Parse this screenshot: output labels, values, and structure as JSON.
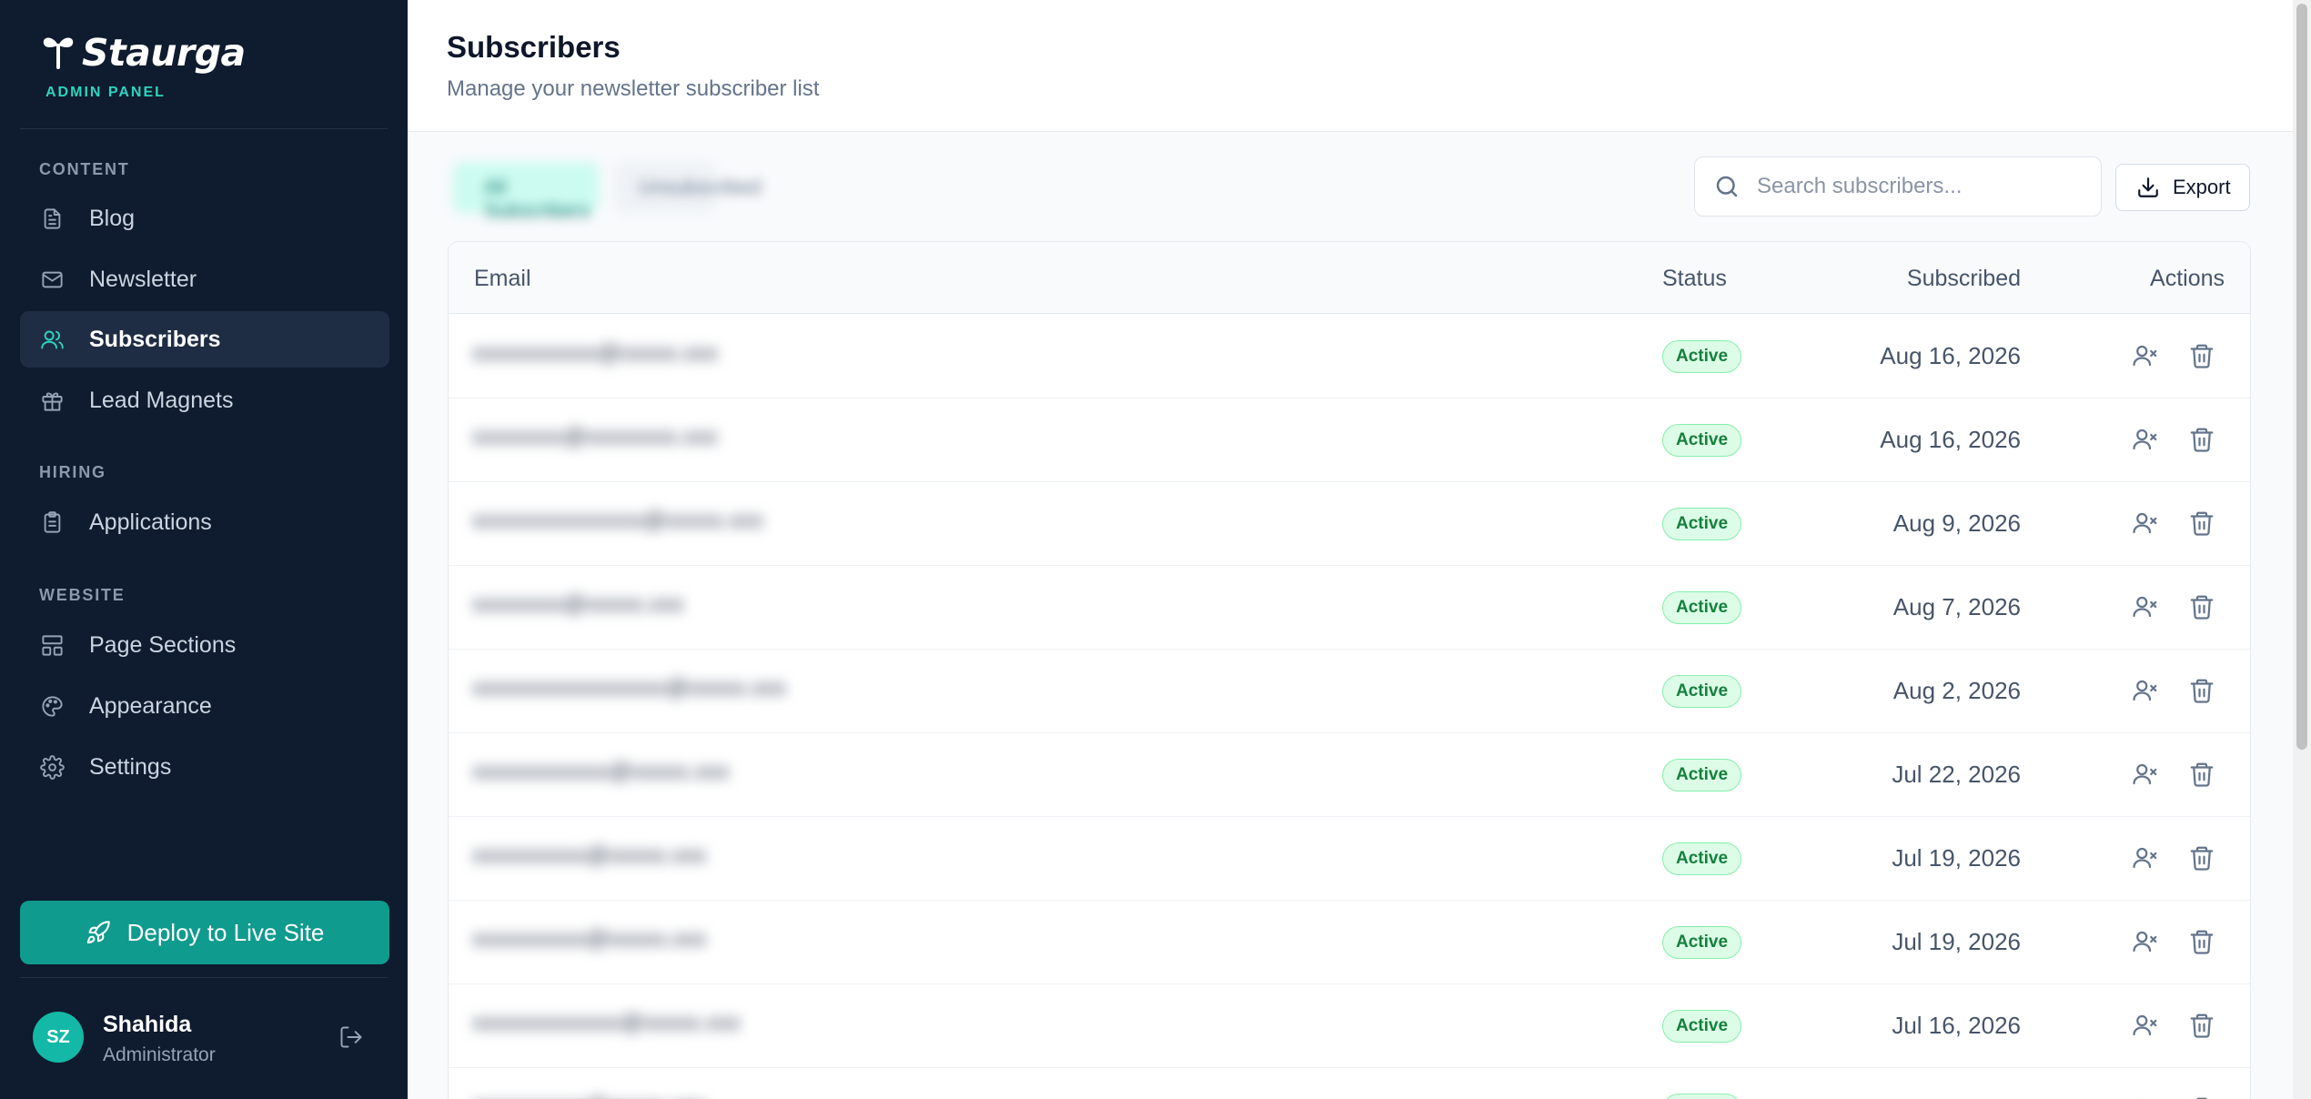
{
  "brand": {
    "name": "Staurga",
    "subtitle": "ADMIN PANEL"
  },
  "sidebar": {
    "sections": [
      {
        "title": "CONTENT",
        "items": [
          {
            "label": "Blog",
            "icon": "document-icon"
          },
          {
            "label": "Newsletter",
            "icon": "mail-icon"
          },
          {
            "label": "Subscribers",
            "icon": "users-icon",
            "active": true
          },
          {
            "label": "Lead Magnets",
            "icon": "gift-icon"
          }
        ]
      },
      {
        "title": "HIRING",
        "items": [
          {
            "label": "Applications",
            "icon": "clipboard-icon"
          }
        ]
      },
      {
        "title": "WEBSITE",
        "items": [
          {
            "label": "Page Sections",
            "icon": "layout-icon"
          },
          {
            "label": "Appearance",
            "icon": "palette-icon"
          },
          {
            "label": "Settings",
            "icon": "gear-icon"
          }
        ]
      }
    ],
    "deploy_label": "Deploy to Live Site",
    "user": {
      "initials": "SZ",
      "name": "Shahida",
      "role": "Administrator"
    }
  },
  "header": {
    "title": "Subscribers",
    "subtitle": "Manage your newsletter subscriber list"
  },
  "filters": {
    "all_label": "All Subscribers",
    "unsubscribed_label": "Unsubscribed"
  },
  "search": {
    "placeholder": "Search subscribers...",
    "value": ""
  },
  "export_label": "Export",
  "table": {
    "columns": {
      "email": "Email",
      "status": "Status",
      "subscribed": "Subscribed",
      "actions": "Actions"
    },
    "rows": [
      {
        "email": "xxxxxxxxxxx@xxxxx.xxx",
        "status": "Active",
        "subscribed": "Aug 16, 2026"
      },
      {
        "email": "xxxxxxxx@xxxxxxxx.xxx",
        "status": "Active",
        "subscribed": "Aug 16, 2026"
      },
      {
        "email": "xxxxxxxxxxxxxxx@xxxxx.xxx",
        "status": "Active",
        "subscribed": "Aug 9, 2026"
      },
      {
        "email": "xxxxxxxx@xxxxx.xxx",
        "status": "Active",
        "subscribed": "Aug 7, 2026"
      },
      {
        "email": "xxxxxxxxxxxxxxxxx@xxxxx.xxx",
        "status": "Active",
        "subscribed": "Aug 2, 2026"
      },
      {
        "email": "xxxxxxxxxxxx@xxxxx.xxx",
        "status": "Active",
        "subscribed": "Jul 22, 2026"
      },
      {
        "email": "xxxxxxxxxx@xxxxx.xxx",
        "status": "Active",
        "subscribed": "Jul 19, 2026"
      },
      {
        "email": "xxxxxxxxxx@xxxxx.xxx",
        "status": "Active",
        "subscribed": "Jul 19, 2026"
      },
      {
        "email": "xxxxxxxxxxxxx@xxxxx.xxx",
        "status": "Active",
        "subscribed": "Jul 16, 2026"
      },
      {
        "email": "xxxxxxxxxx@xxxxx.xxx",
        "status": "Active",
        "subscribed": ""
      }
    ]
  },
  "colors": {
    "sidebar_bg": "#0f1b2e",
    "accent": "#0f9b8e",
    "active_badge_bg": "#dcfce7",
    "active_badge_text": "#15803d"
  }
}
